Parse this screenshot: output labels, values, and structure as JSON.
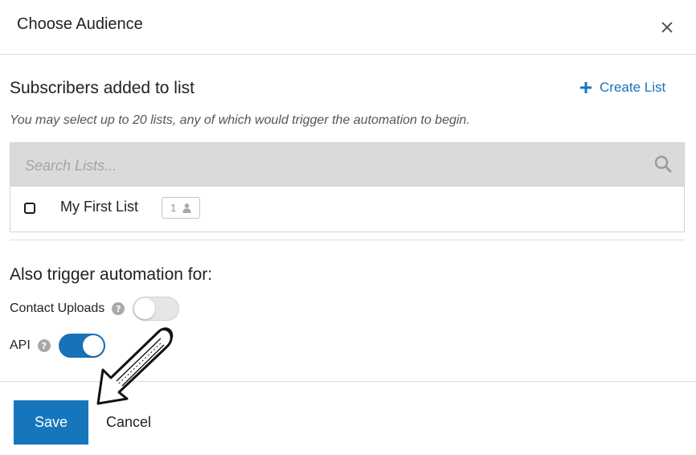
{
  "modal": {
    "title": "Choose Audience"
  },
  "audience": {
    "section_title": "Subscribers added to list",
    "create_list_label": "Create List",
    "hint": "You may select up to 20 lists, any of which would trigger the automation to begin.",
    "search": {
      "placeholder": "Search Lists...",
      "value": ""
    },
    "lists": [
      {
        "name": "My First List",
        "count": "1",
        "checked": false
      }
    ]
  },
  "triggers": {
    "title": "Also trigger automation for:",
    "options": [
      {
        "label": "Contact Uploads",
        "enabled": false
      },
      {
        "label": "API",
        "enabled": true
      }
    ]
  },
  "footer": {
    "save_label": "Save",
    "cancel_label": "Cancel"
  },
  "colors": {
    "accent": "#1773b8",
    "toggle_off": "#e6e6e6",
    "search_bar": "#dadada"
  }
}
